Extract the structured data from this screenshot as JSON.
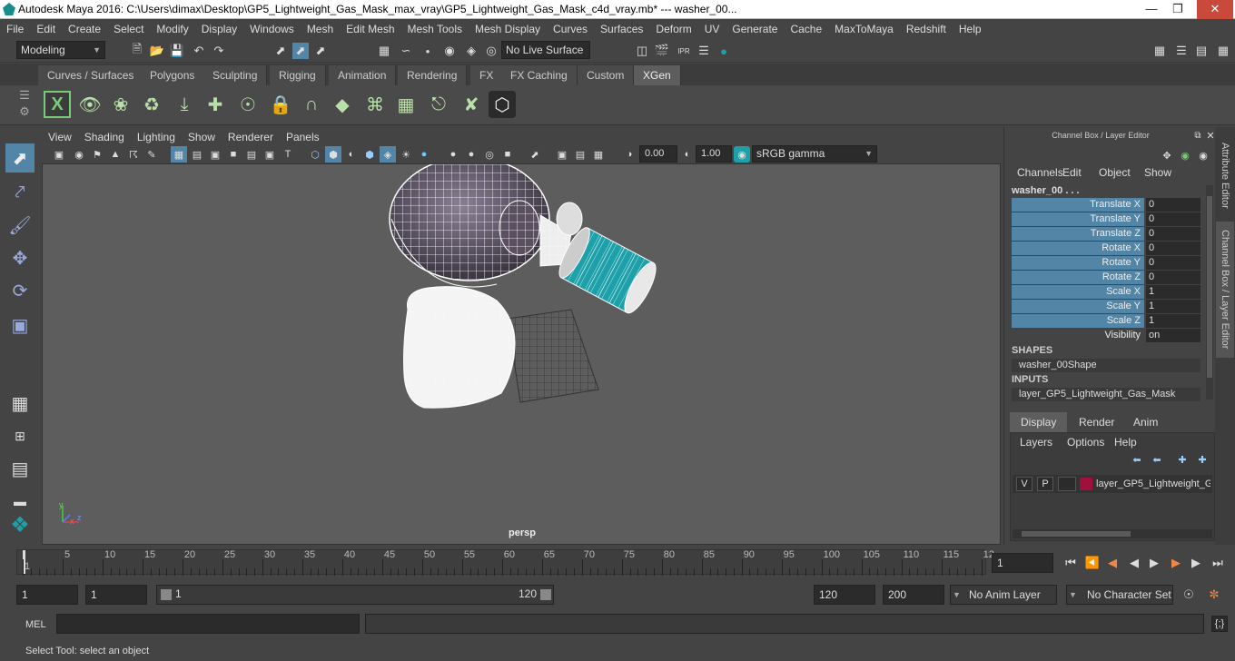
{
  "window": {
    "title": "Autodesk Maya 2016: C:\\Users\\dimax\\Desktop\\GP5_Lightweight_Gas_Mask_max_vray\\GP5_Lightweight_Gas_Mask_c4d_vray.mb*   ---   washer_00..."
  },
  "menubar": [
    "File",
    "Edit",
    "Create",
    "Select",
    "Modify",
    "Display",
    "Windows",
    "Mesh",
    "Edit Mesh",
    "Mesh Tools",
    "Mesh Display",
    "Curves",
    "Surfaces",
    "Deform",
    "UV",
    "Generate",
    "Cache",
    "MaxToMaya",
    "Redshift",
    "Help"
  ],
  "status": {
    "mode": "Modeling",
    "live_surface": "No Live Surface"
  },
  "shelf_tabs": [
    "Curves / Surfaces",
    "Polygons",
    "Sculpting",
    "Rigging",
    "Animation",
    "Rendering",
    "FX",
    "FX Caching",
    "Custom",
    "XGen"
  ],
  "active_shelf": "XGen",
  "viewport": {
    "menu": [
      "View",
      "Shading",
      "Lighting",
      "Show",
      "Renderer",
      "Panels"
    ],
    "exposure": "0.00",
    "gamma": "1.00",
    "color_space": "sRGB gamma",
    "camera_label": "persp",
    "axis_x": "x",
    "axis_y": "y",
    "axis_z": "z"
  },
  "channel_box": {
    "title": "Channel Box / Layer Editor",
    "menu": [
      "Channels",
      "Edit",
      "Object",
      "Show"
    ],
    "object_name": "washer_00 . . .",
    "channels": [
      {
        "name": "Translate X",
        "value": "0"
      },
      {
        "name": "Translate Y",
        "value": "0"
      },
      {
        "name": "Translate Z",
        "value": "0"
      },
      {
        "name": "Rotate X",
        "value": "0"
      },
      {
        "name": "Rotate Y",
        "value": "0"
      },
      {
        "name": "Rotate Z",
        "value": "0"
      },
      {
        "name": "Scale X",
        "value": "1"
      },
      {
        "name": "Scale Y",
        "value": "1"
      },
      {
        "name": "Scale Z",
        "value": "1"
      },
      {
        "name": "Visibility",
        "value": "on"
      }
    ],
    "shapes_header": "SHAPES",
    "shape_name": "washer_00Shape",
    "inputs_header": "INPUTS",
    "input_name": "layer_GP5_Lightweight_Gas_Mask"
  },
  "layer_editor": {
    "tabs": [
      "Display",
      "Render",
      "Anim"
    ],
    "menu": [
      "Layers",
      "Options",
      "Help"
    ],
    "layer": {
      "v": "V",
      "p": "P",
      "name": "layer_GP5_Lightweight_G",
      "color": "#a0103a"
    }
  },
  "side_tabs": [
    "Attribute Editor",
    "Channel Box / Layer Editor"
  ],
  "timeline": {
    "ticks": [
      "1",
      "5",
      "10",
      "15",
      "20",
      "25",
      "30",
      "35",
      "40",
      "45",
      "50",
      "55",
      "60",
      "65",
      "70",
      "75",
      "80",
      "85",
      "90",
      "95",
      "100",
      "105",
      "110",
      "115",
      "12"
    ],
    "current_frame": "1"
  },
  "range": {
    "start": "1",
    "playback_start": "1",
    "slider_start": "1",
    "slider_end": "120",
    "playback_end": "120",
    "end": "200",
    "anim_layer": "No Anim Layer",
    "character_set": "No Character Set"
  },
  "command_line": {
    "label": "MEL"
  },
  "help_line": "Select Tool: select an object",
  "colors": {
    "accent_teal": "#1fa0a8",
    "channel_blue": "#5285a6",
    "layer_red": "#a0103a"
  }
}
